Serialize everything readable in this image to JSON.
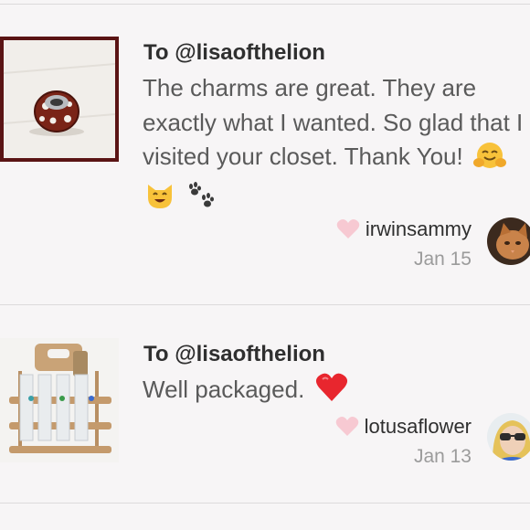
{
  "reviews": [
    {
      "recipient": "To @lisaofthelion",
      "message": "The charms are great. They are exactly what I wanted. So glad that I visited your closet. Thank You!",
      "emojis": [
        "hugging-face-icon",
        "smiling-cat-icon",
        "paw-prints-icon"
      ],
      "username": "irwinsammy",
      "date": "Jan 15",
      "thumbnail": "charm-bead-photo",
      "avatar": "cat-avatar"
    },
    {
      "recipient": "To @lisaofthelion",
      "message": "Well packaged.",
      "emojis": [
        "red-heart-icon"
      ],
      "username": "lotusaflower",
      "date": "Jan 13",
      "thumbnail": "glass-caddy-photo",
      "avatar": "sunglasses-avatar"
    }
  ],
  "colors": {
    "background": "#f7f5f6",
    "heart_like": "#f7c9d2",
    "divider": "#dcdadb",
    "date_text": "#9b9b9b"
  }
}
